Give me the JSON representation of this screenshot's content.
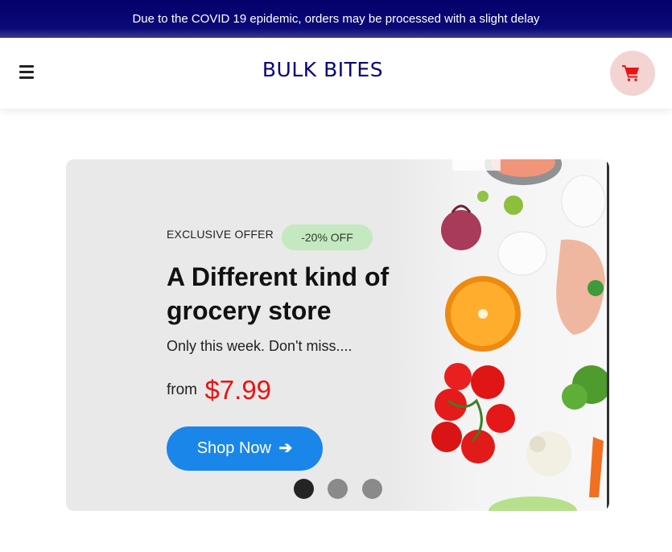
{
  "announcement": {
    "text": "Due to the COVID 19 epidemic, orders may be processed with a slight delay"
  },
  "header": {
    "logo": "BULK BITES",
    "menu_icon": "hamburger-menu-icon",
    "cart_icon": "shopping-cart-icon"
  },
  "hero": {
    "offer_label": "EXCLUSIVE OFFER",
    "discount_badge": "-20% OFF",
    "headline_line1": "A Different kind of",
    "headline_line2": "grocery store",
    "subtitle": "Only this week. Don't miss....",
    "price_prefix": "from",
    "price": "$7.99",
    "cta_label": "Shop Now",
    "cta_icon": "arrow-right-icon",
    "carousel_slides": 3,
    "carousel_active": 1
  },
  "colors": {
    "announcement_bg": "#05006a",
    "logo": "#06057a",
    "cart_bg": "#f4d3d3",
    "cart_icon": "#ee1111",
    "badge_bg": "#c4e8c0",
    "price": "#ee1111",
    "cta_bg": "#1a86ea",
    "dot_active": "#242424",
    "dot_inactive": "#8a8a8a"
  }
}
